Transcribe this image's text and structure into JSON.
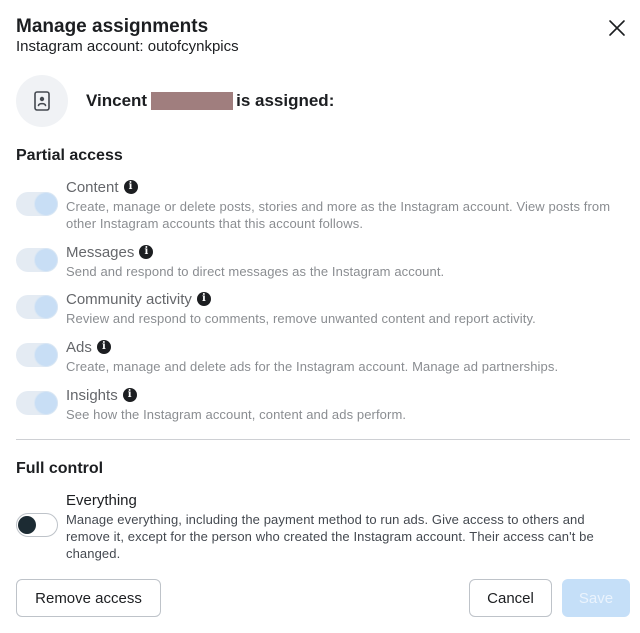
{
  "dialog": {
    "title": "Manage assignments",
    "subtitle": "Instagram account: outofcynkpics",
    "close_icon": "close-icon"
  },
  "assignee": {
    "first_name": "Vincent",
    "suffix": "is assigned:",
    "avatar_icon": "contact-card-icon"
  },
  "partial_access": {
    "heading": "Partial access",
    "items": [
      {
        "title": "Content",
        "enabled": true,
        "disabled": true,
        "description": "Create, manage or delete posts, stories and more as the Instagram account. View posts from other Instagram accounts that this account follows."
      },
      {
        "title": "Messages",
        "enabled": true,
        "disabled": true,
        "description": "Send and respond to direct messages as the Instagram account."
      },
      {
        "title": "Community activity",
        "enabled": true,
        "disabled": true,
        "description": "Review and respond to comments, remove unwanted content and report activity."
      },
      {
        "title": "Ads",
        "enabled": true,
        "disabled": true,
        "description": "Create, manage and delete ads for the Instagram account. Manage ad partnerships."
      },
      {
        "title": "Insights",
        "enabled": true,
        "disabled": true,
        "description": "See how the Instagram account, content and ads perform."
      }
    ]
  },
  "full_control": {
    "heading": "Full control",
    "item": {
      "title": "Everything",
      "enabled": false,
      "description": "Manage everything, including the payment method to run ads. Give access to others and remove it, except for the person who created the Instagram account. Their access can't be changed."
    }
  },
  "footer": {
    "remove_label": "Remove access",
    "cancel_label": "Cancel",
    "save_label": "Save"
  },
  "colors": {
    "toggle_disabled_track": "#e4ebf3",
    "toggle_disabled_knob": "#c8def5",
    "save_disabled_bg": "#c5dff8",
    "redaction": "#a07e7e"
  }
}
